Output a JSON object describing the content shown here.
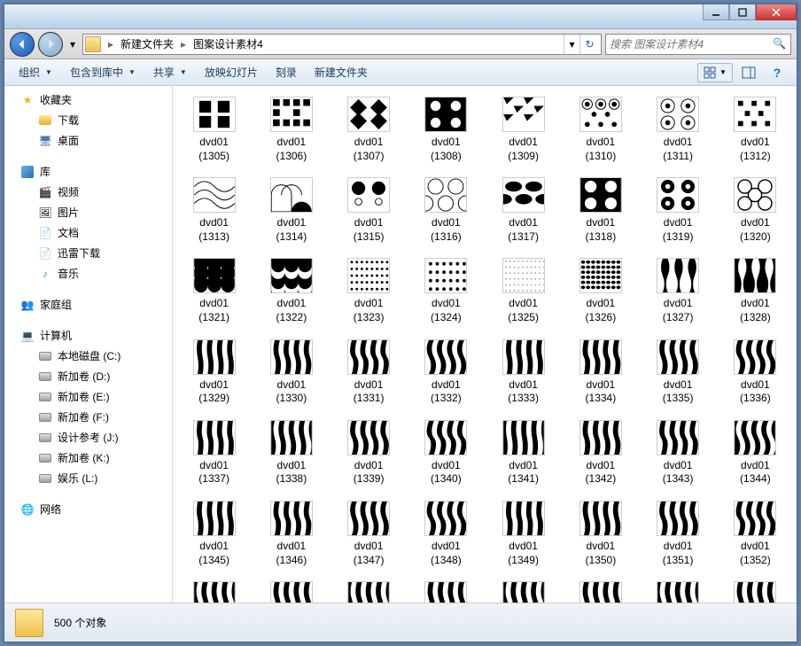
{
  "path": {
    "seg1": "新建文件夹",
    "seg2": "图案设计素材4"
  },
  "search": {
    "placeholder": "搜索 图案设计素材4"
  },
  "toolbar": {
    "organize": "组织",
    "include": "包含到库中",
    "share": "共享",
    "slideshow": "放映幻灯片",
    "burn": "刻录",
    "newfolder": "新建文件夹"
  },
  "sidebar": {
    "favorites": "收藏夹",
    "downloads": "下载",
    "desktop": "桌面",
    "libraries": "库",
    "videos": "视频",
    "pictures": "图片",
    "documents": "文档",
    "thunder": "迅雷下载",
    "music": "音乐",
    "homegroup": "家庭组",
    "computer": "计算机",
    "drives": [
      "本地磁盘 (C:)",
      "新加卷 (D:)",
      "新加卷 (E:)",
      "新加卷 (F:)",
      "设计参考 (J:)",
      "新加卷 (K:)",
      "娱乐 (L:)"
    ],
    "network": "网络"
  },
  "files": [
    {
      "name": "dvd01",
      "num": "(1305)"
    },
    {
      "name": "dvd01",
      "num": "(1306)"
    },
    {
      "name": "dvd01",
      "num": "(1307)"
    },
    {
      "name": "dvd01",
      "num": "(1308)"
    },
    {
      "name": "dvd01",
      "num": "(1309)"
    },
    {
      "name": "dvd01",
      "num": "(1310)"
    },
    {
      "name": "dvd01",
      "num": "(1311)"
    },
    {
      "name": "dvd01",
      "num": "(1312)"
    },
    {
      "name": "dvd01",
      "num": "(1313)"
    },
    {
      "name": "dvd01",
      "num": "(1314)"
    },
    {
      "name": "dvd01",
      "num": "(1315)"
    },
    {
      "name": "dvd01",
      "num": "(1316)"
    },
    {
      "name": "dvd01",
      "num": "(1317)"
    },
    {
      "name": "dvd01",
      "num": "(1318)"
    },
    {
      "name": "dvd01",
      "num": "(1319)"
    },
    {
      "name": "dvd01",
      "num": "(1320)"
    },
    {
      "name": "dvd01",
      "num": "(1321)"
    },
    {
      "name": "dvd01",
      "num": "(1322)"
    },
    {
      "name": "dvd01",
      "num": "(1323)"
    },
    {
      "name": "dvd01",
      "num": "(1324)"
    },
    {
      "name": "dvd01",
      "num": "(1325)"
    },
    {
      "name": "dvd01",
      "num": "(1326)"
    },
    {
      "name": "dvd01",
      "num": "(1327)"
    },
    {
      "name": "dvd01",
      "num": "(1328)"
    },
    {
      "name": "dvd01",
      "num": "(1329)"
    },
    {
      "name": "dvd01",
      "num": "(1330)"
    },
    {
      "name": "dvd01",
      "num": "(1331)"
    },
    {
      "name": "dvd01",
      "num": "(1332)"
    },
    {
      "name": "dvd01",
      "num": "(1333)"
    },
    {
      "name": "dvd01",
      "num": "(1334)"
    },
    {
      "name": "dvd01",
      "num": "(1335)"
    },
    {
      "name": "dvd01",
      "num": "(1336)"
    },
    {
      "name": "dvd01",
      "num": "(1337)"
    },
    {
      "name": "dvd01",
      "num": "(1338)"
    },
    {
      "name": "dvd01",
      "num": "(1339)"
    },
    {
      "name": "dvd01",
      "num": "(1340)"
    },
    {
      "name": "dvd01",
      "num": "(1341)"
    },
    {
      "name": "dvd01",
      "num": "(1342)"
    },
    {
      "name": "dvd01",
      "num": "(1343)"
    },
    {
      "name": "dvd01",
      "num": "(1344)"
    },
    {
      "name": "dvd01",
      "num": "(1345)"
    },
    {
      "name": "dvd01",
      "num": "(1346)"
    },
    {
      "name": "dvd01",
      "num": "(1347)"
    },
    {
      "name": "dvd01",
      "num": "(1348)"
    },
    {
      "name": "dvd01",
      "num": "(1349)"
    },
    {
      "name": "dvd01",
      "num": "(1350)"
    },
    {
      "name": "dvd01",
      "num": "(1351)"
    },
    {
      "name": "dvd01",
      "num": "(1352)"
    },
    {
      "name": "",
      "num": ""
    },
    {
      "name": "",
      "num": ""
    },
    {
      "name": "",
      "num": ""
    },
    {
      "name": "",
      "num": ""
    },
    {
      "name": "",
      "num": ""
    },
    {
      "name": "",
      "num": ""
    },
    {
      "name": "",
      "num": ""
    },
    {
      "name": "",
      "num": ""
    }
  ],
  "status": {
    "count": "500 个对象"
  }
}
